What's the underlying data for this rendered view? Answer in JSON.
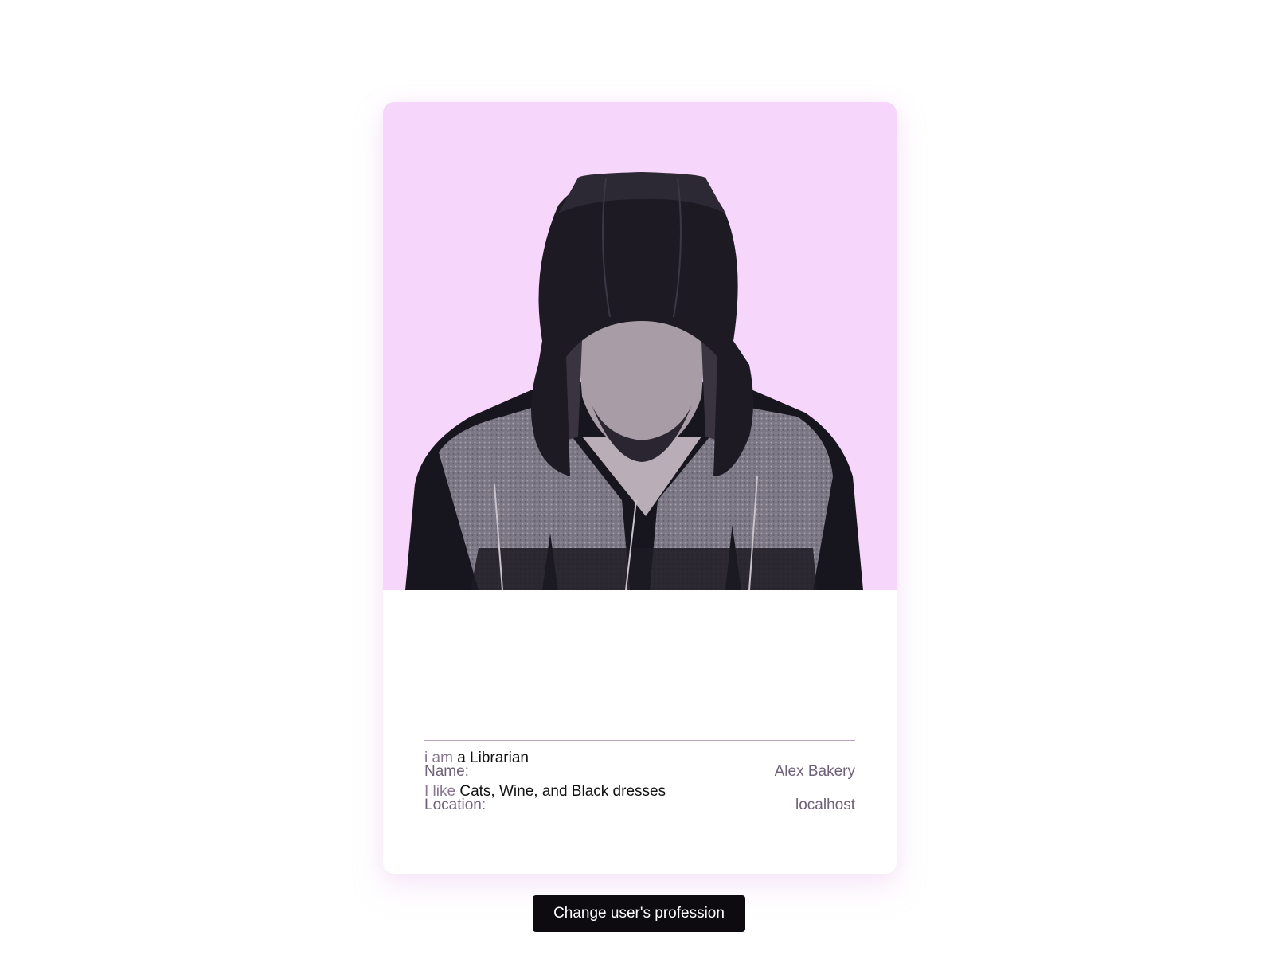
{
  "card": {
    "photo_alt": "hooded-man-portrait",
    "bio": {
      "profession_prefix": "i am",
      "profession": "a Librarian",
      "likes_prefix": "I like",
      "likes": "Cats, Wine, and Black dresses"
    },
    "meta": [
      {
        "label": "Name:",
        "value": "Alex Bakery"
      },
      {
        "label": "Location:",
        "value": "localhost"
      }
    ]
  },
  "actions": {
    "change_profession_label": "Change user's profession"
  },
  "colors": {
    "photo_background": "#f7d6fb",
    "button_background": "#0d0b10",
    "muted_text": "#8a7890"
  }
}
